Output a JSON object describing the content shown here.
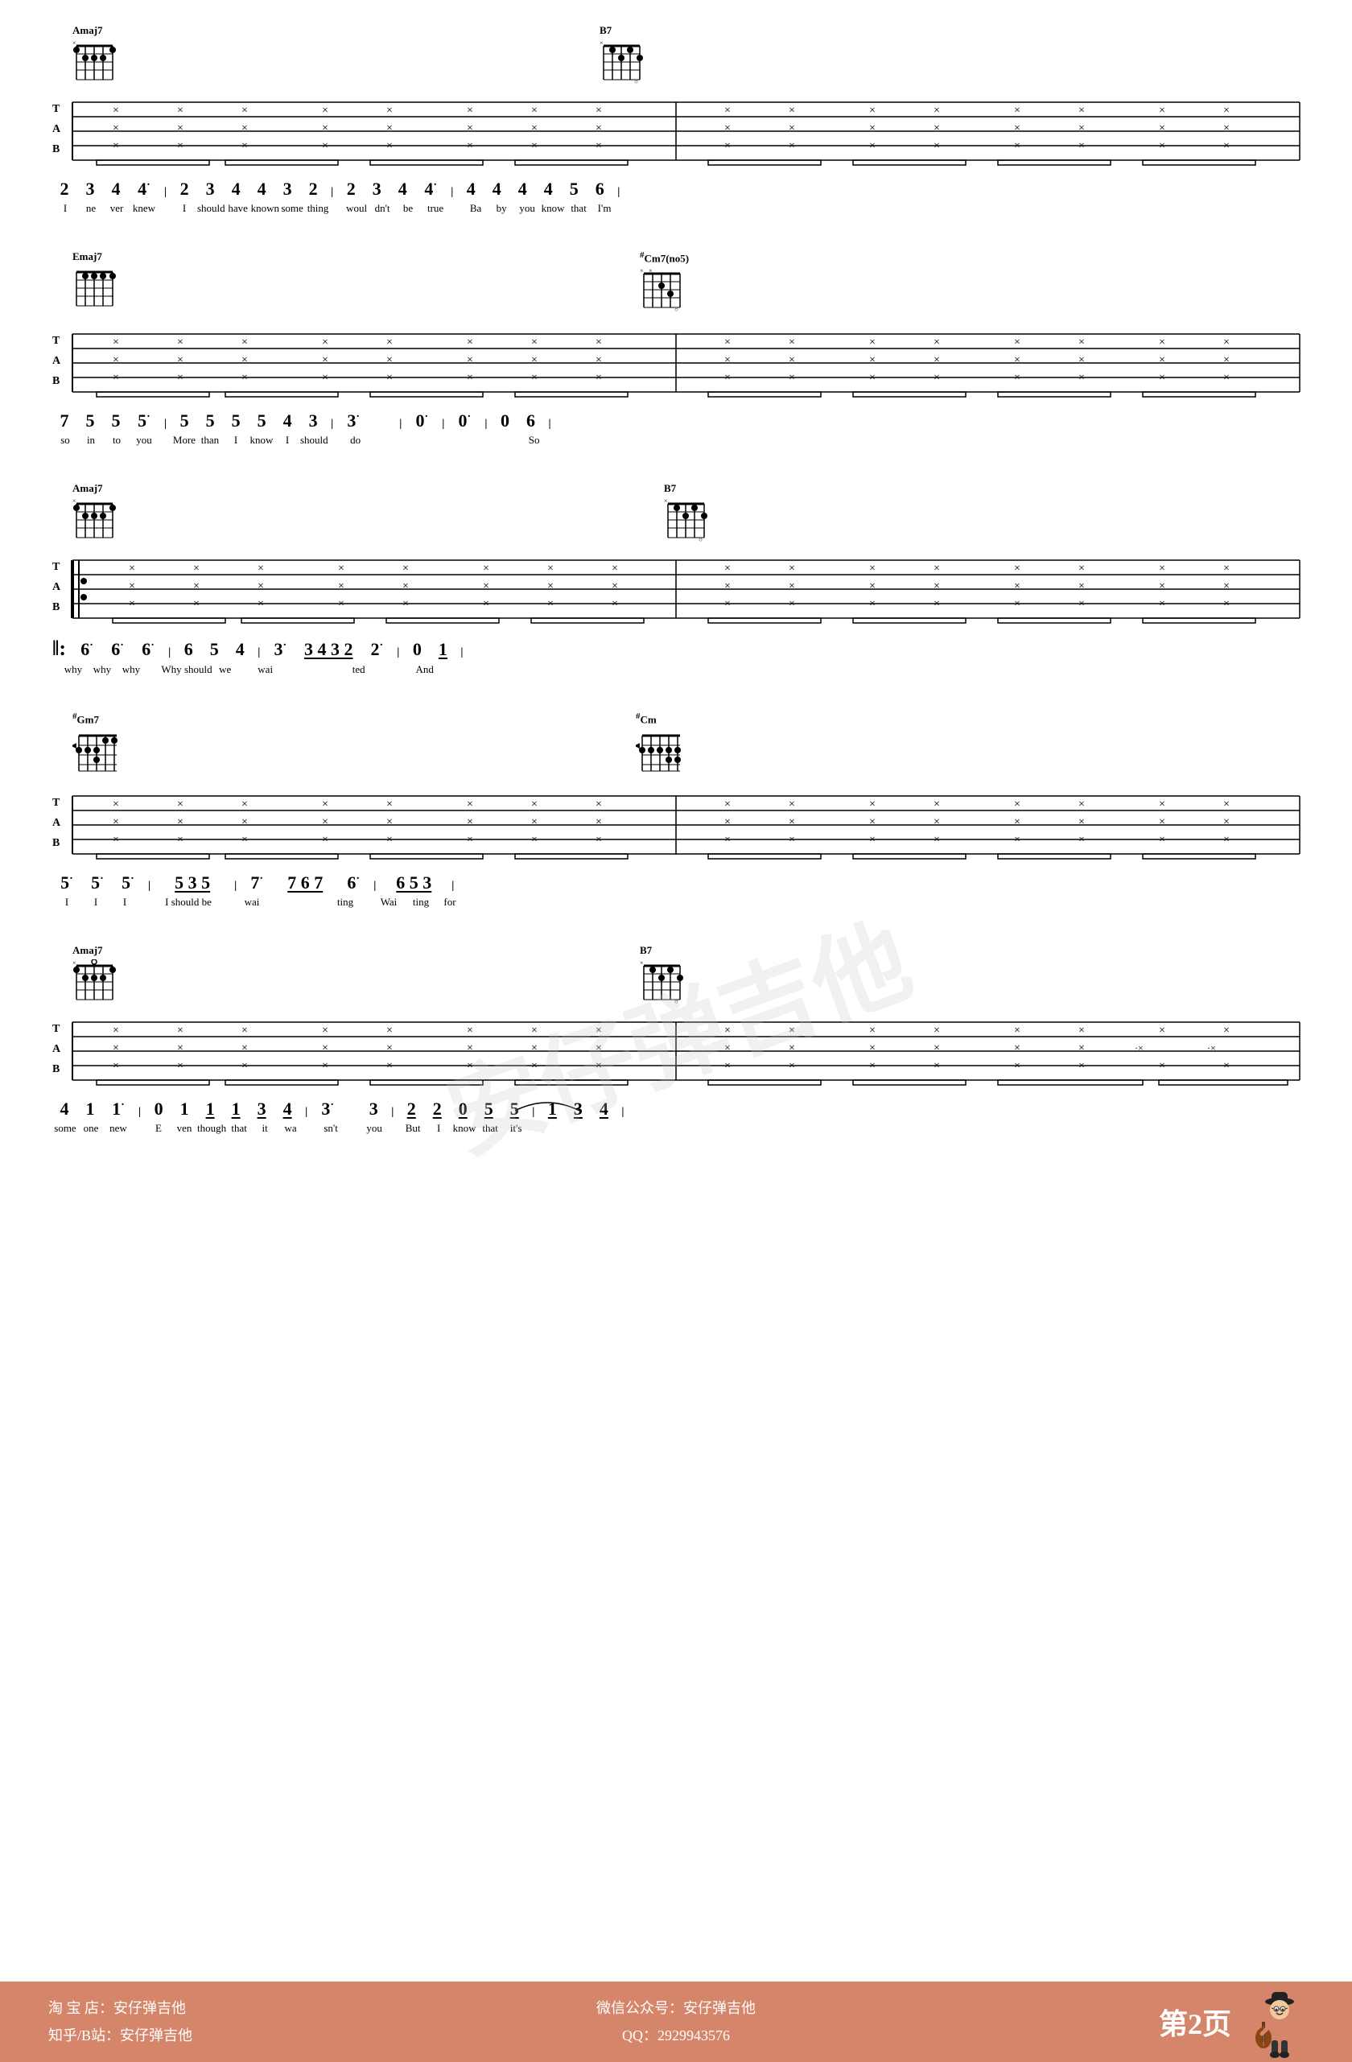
{
  "page": {
    "number": "第2页",
    "watermark": "安仔弹吉他",
    "background": "#ffffff"
  },
  "footer": {
    "left_line1": "淘 宝 店：安仔弹吉他",
    "left_line2": "知乎/B站：安仔弹吉他",
    "center_line1": "微信公众号：安仔弹吉他",
    "center_line2": "QQ：2929943576",
    "page_label": "第2页"
  },
  "sections": [
    {
      "id": "section1",
      "chords_left": {
        "name": "Amaj7",
        "position_left": true
      },
      "chords_right": {
        "name": "B7",
        "position_right": true
      },
      "numbered_notation": "2 3 4 4• | 2 3 4 4 3 2 | 2 3 4 4• | 4 4 4 4 5 6 |",
      "lyrics": "I ne ver knew   I should have known some thing   woul dn't be true   Ba by you know that I'm"
    },
    {
      "id": "section2",
      "chords_left": {
        "name": "Emaj7"
      },
      "chords_right": {
        "name": "#Cm7(no5)"
      },
      "numbered_notation": "7 5 5 5• | 5 5 5 5 4 3 | 3• | 0• | 0• | 0 6 |",
      "lyrics": "so in to you   More than I know I should do               So"
    },
    {
      "id": "section3",
      "chords_left": {
        "name": "Amaj7"
      },
      "chords_right": {
        "name": "B7"
      },
      "repeat_start": true,
      "numbered_notation": "6• 6• 6• | 6 5 4 | 3• 3 4 3 2• | 0 1 |",
      "lyrics": "why why why   Why should we wai   ted   And"
    },
    {
      "id": "section4",
      "chords_left": {
        "name": "#Gm7"
      },
      "chords_right": {
        "name": "#Cm"
      },
      "numbered_notation": "5• 5• 5• | 5 3 5 | 7• 7 6 7 6• | 6 5 3 |",
      "lyrics": "I   I   I   I should be wai   ting   Wai ting for"
    },
    {
      "id": "section5",
      "chords_left": {
        "name": "Amaj7"
      },
      "chords_right": {
        "name": "B7"
      },
      "numbered_notation": "4 1 1• | 0 1 1 1 3 4 | 3• 3 2 2 0 5 5 1 3 4 |",
      "lyrics": "some one new   E ven though that it wa   sn't you   But I know that it's"
    }
  ]
}
